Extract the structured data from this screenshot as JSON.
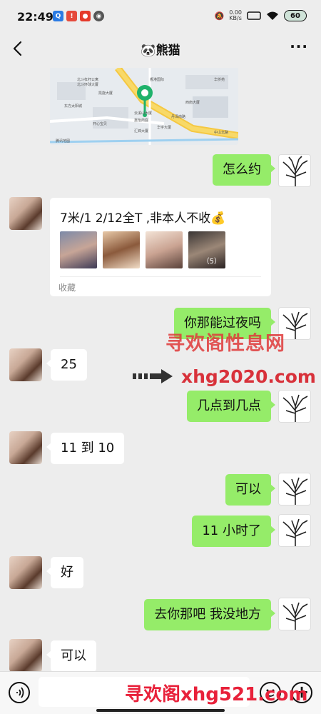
{
  "status_bar": {
    "time": "22:49",
    "net_speed_value": "0.00",
    "net_speed_unit": "KB/s",
    "battery": "60"
  },
  "nav": {
    "title": "熊猫",
    "title_emoji": "🐼"
  },
  "messages": [
    {
      "side": "right",
      "text": "怎么约"
    },
    {
      "side": "left",
      "type": "favorite",
      "text": "7米/1   2/12全T ,非本人不收💰",
      "label": "收藏",
      "thumb_count": "（5）"
    },
    {
      "side": "right",
      "text": "你那能过夜吗"
    },
    {
      "side": "left",
      "text": "25"
    },
    {
      "side": "right",
      "text": "几点到几点"
    },
    {
      "side": "left",
      "text": "11 到 10"
    },
    {
      "side": "right",
      "text": "可以"
    },
    {
      "side": "right",
      "text": "11 小时了"
    },
    {
      "side": "left",
      "text": "好"
    },
    {
      "side": "right",
      "text": "去你那吧 我没地方"
    },
    {
      "side": "left",
      "text": "可以"
    }
  ],
  "map": {
    "labels": [
      "北斗杠杆公寓",
      "北斗环球大厦",
      "凯旋大厦",
      "东方太阳城",
      "开心宝贝",
      "云溪山大厦",
      "嘉怡商庭",
      "汇锦大厦",
      "丹泽南路",
      "香港国际",
      "西南大厦",
      "华宇大厦",
      "华侨苑",
      "中山北路",
      "腾讯地图"
    ]
  },
  "watermarks": {
    "line1": "寻欢阁性息网",
    "line2": "xhg2020.com",
    "line3": "寻欢阁xhg521.com"
  },
  "colors": {
    "me_bubble": "#95ec69",
    "other_bubble": "#ffffff",
    "background": "#ededed",
    "watermark": "#e03a3a"
  }
}
